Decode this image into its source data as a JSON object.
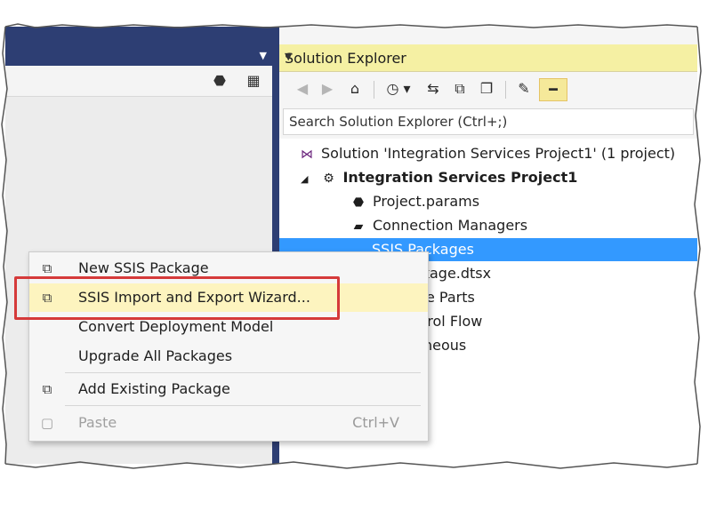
{
  "solution_explorer": {
    "title": "Solution Explorer",
    "search_placeholder": "Search Solution Explorer (Ctrl+;)",
    "toolbar_icons": [
      "back-icon",
      "forward-icon",
      "home-icon",
      "history-icon",
      "sync-icon",
      "collapse-icon",
      "show-all-files-icon",
      "properties-icon",
      "pin-icon"
    ],
    "tree": {
      "solution": "Solution 'Integration Services Project1' (1 project)",
      "project": "Integration Services Project1",
      "items": [
        "Project.params",
        "Connection Managers",
        "SSIS Packages",
        "kage.dtsx",
        "e Parts",
        "trol Flow",
        "neous"
      ]
    }
  },
  "context_menu": {
    "items": [
      {
        "label": "New SSIS Package",
        "icon": "package-icon"
      },
      {
        "label": "SSIS Import and Export Wizard...",
        "icon": "wizard-icon"
      },
      {
        "label": "Convert Deployment Model",
        "icon": ""
      },
      {
        "label": "Upgrade All Packages",
        "icon": ""
      },
      {
        "label": "Add Existing Package",
        "icon": "add-package-icon"
      },
      {
        "label": "Paste",
        "icon": "paste-icon",
        "shortcut": "Ctrl+V"
      }
    ]
  },
  "colors": {
    "frame": "#3f4d73",
    "title_bar": "#2d3e73",
    "se_title": "#f5f0a3",
    "selection": "#3399ff",
    "highlight_box": "#d53a3a",
    "menu_hover": "#fdf4bf"
  }
}
